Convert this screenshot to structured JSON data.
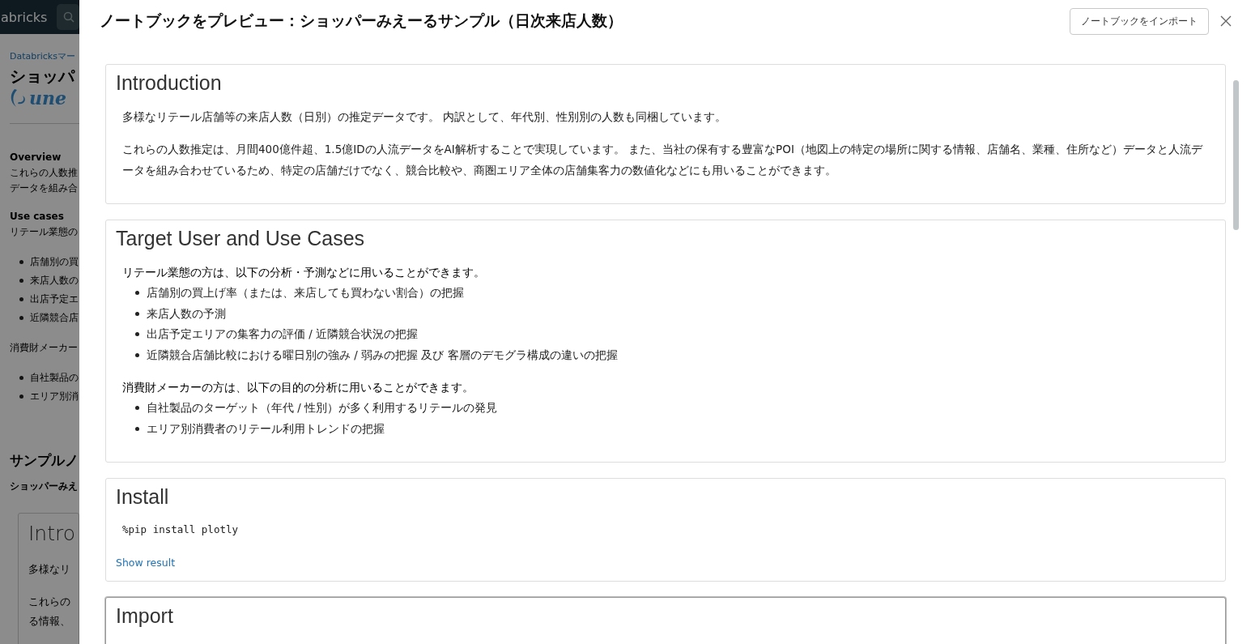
{
  "background": {
    "brand": "abricks",
    "breadcrumb": "Databricksマー",
    "title": "ショッパ",
    "logo_text": "une",
    "items": [
      {
        "kind": "label",
        "text": "Overview"
      },
      {
        "kind": "text",
        "text": "これらの人数推"
      },
      {
        "kind": "text",
        "text": "データを組み合"
      },
      {
        "kind": "gap"
      },
      {
        "kind": "label",
        "text": "Use cases"
      },
      {
        "kind": "text",
        "text": "リテール業態の"
      },
      {
        "kind": "gap"
      },
      {
        "kind": "bullet",
        "text": "店舗別の買"
      },
      {
        "kind": "bullet",
        "text": "来店人数の"
      },
      {
        "kind": "bullet",
        "text": "出店予定エ"
      },
      {
        "kind": "bullet",
        "text": "近隣競合店"
      },
      {
        "kind": "gap"
      },
      {
        "kind": "text",
        "text": "消費財メーカー"
      },
      {
        "kind": "gap"
      },
      {
        "kind": "bullet",
        "text": "自社製品の"
      },
      {
        "kind": "bullet",
        "text": "エリア別消"
      },
      {
        "kind": "biggap"
      },
      {
        "kind": "heading",
        "text": "サンプルノ"
      },
      {
        "kind": "bold",
        "text": "ショッパーみえ"
      }
    ],
    "card": {
      "title": "Intro",
      "lines": [
        "多様なリ",
        "これらの",
        "る情報、"
      ]
    }
  },
  "modal": {
    "title": "ノートブックをプレビュー：ショッパーみえーるサンプル（日次来店人数）",
    "import_button": "ノートブックをインポート"
  },
  "cells": [
    {
      "kind": "markdown",
      "title": "Introduction",
      "selected": false,
      "blocks": [
        {
          "kind": "paragraph",
          "text": "多様なリテール店舗等の来店人数（日別）の推定データです。 内訳として、年代別、性別別の人数も同梱しています。"
        },
        {
          "kind": "paragraph",
          "text": "これらの人数推定は、月間400億件超、1.5億IDの人流データをAI解析することで実現しています。 また、当社の保有する豊富なPOI（地図上の特定の場所に関する情報、店舗名、業種、住所など）データと人流データを組み合わせているため、特定の店舗だけでなく、競合比較や、商圏エリア全体の店舗集客力の数値化などにも用いることができます。"
        }
      ]
    },
    {
      "kind": "markdown",
      "title": "Target User and Use Cases",
      "selected": false,
      "blocks": [
        {
          "kind": "list",
          "text": "リテール業態の方は、以下の分析・予測などに用いることができます。",
          "items": [
            "店舗別の買上げ率（または、来店しても買わない割合）の把握",
            "来店人数の予測",
            "出店予定エリアの集客力の評価 / 近隣競合状況の把握",
            "近隣競合店舗比較における曜日別の強み / 弱みの把握 及び 客層のデモグラ構成の違いの把握"
          ]
        },
        {
          "kind": "list",
          "text": "消費財メーカーの方は、以下の目的の分析に用いることができます。",
          "items": [
            "自社製品のターゲット（年代 / 性別）が多く利用するリテールの発見",
            "エリア別消費者のリテール利用トレンドの把握"
          ]
        }
      ]
    },
    {
      "kind": "code",
      "title": "Install",
      "selected": false,
      "code": "%pip install plotly",
      "link": "Show result"
    },
    {
      "kind": "markdown",
      "title": "Import",
      "selected": true
    }
  ]
}
